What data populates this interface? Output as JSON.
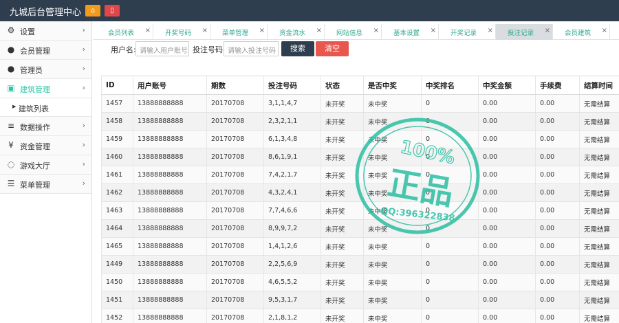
{
  "app": {
    "title": "九城后台管理中心"
  },
  "topbar": {
    "home_icon": "home-icon",
    "trash_icon": "trash-icon",
    "home_color": "#f29a1a",
    "trash_color": "#e0464a"
  },
  "sidebar": {
    "items": [
      {
        "icon": "gear-icon",
        "glyph": "⚙",
        "label": "设置",
        "active": false
      },
      {
        "icon": "user-icon",
        "glyph": "●",
        "label": "会员管理",
        "active": false
      },
      {
        "icon": "users-icon",
        "glyph": "●",
        "label": "管理员",
        "active": false
      },
      {
        "icon": "building-icon",
        "glyph": "▣",
        "label": "建筑管理",
        "active": true
      },
      {
        "icon": "database-icon",
        "glyph": "≡",
        "label": "数据操作",
        "active": false
      },
      {
        "icon": "yen-icon",
        "glyph": "¥",
        "label": "资金管理",
        "active": false
      },
      {
        "icon": "circle-icon",
        "glyph": "◌",
        "label": "游戏大厅",
        "active": false
      },
      {
        "icon": "list-icon",
        "glyph": "☰",
        "label": "菜单管理",
        "active": false
      }
    ],
    "subitem": {
      "label": "建筑列表"
    },
    "accent": "#2ec4a6"
  },
  "tabs": [
    {
      "label": "会员列表",
      "active": false
    },
    {
      "label": "开奖号码",
      "active": false
    },
    {
      "label": "菜单管理",
      "active": false
    },
    {
      "label": "资金流水",
      "active": false
    },
    {
      "label": "网站信息",
      "active": false
    },
    {
      "label": "基本设置",
      "active": false
    },
    {
      "label": "开奖记录",
      "active": false
    },
    {
      "label": "投注记录",
      "active": true
    },
    {
      "label": "会员建筑",
      "active": false
    }
  ],
  "search": {
    "user_label": "用户名:",
    "user_placeholder": "请输入用户账号",
    "bet_label": "投注号码:",
    "bet_placeholder": "请输入投注号码",
    "search_button": "搜索",
    "clear_button": "清空",
    "search_color": "#2f3e4f",
    "clear_color": "#e8574e"
  },
  "table": {
    "columns": [
      "ID",
      "用户账号",
      "期数",
      "投注号码",
      "状态",
      "是否中奖",
      "中奖排名",
      "中奖金额",
      "手续费",
      "结算时间"
    ],
    "rows": [
      [
        "1457",
        "13888888888",
        "20170708",
        "3,1,1,4,7",
        "未开奖",
        "未中奖",
        "0",
        "0.00",
        "0.00",
        "无需结算"
      ],
      [
        "1458",
        "13888888888",
        "20170708",
        "2,3,2,1,1",
        "未开奖",
        "未中奖",
        "0",
        "0.00",
        "0.00",
        "无需结算"
      ],
      [
        "1459",
        "13888888888",
        "20170708",
        "6,1,3,4,8",
        "未开奖",
        "未中奖",
        "0",
        "0.00",
        "0.00",
        "无需结算"
      ],
      [
        "1460",
        "13888888888",
        "20170708",
        "8,6,1,9,1",
        "未开奖",
        "未中奖",
        "0",
        "0.00",
        "0.00",
        "无需结算"
      ],
      [
        "1461",
        "13888888888",
        "20170708",
        "7,4,2,1,7",
        "未开奖",
        "未中奖",
        "0",
        "0.00",
        "0.00",
        "无需结算"
      ],
      [
        "1462",
        "13888888888",
        "20170708",
        "4,3,2,4,1",
        "未开奖",
        "未中奖",
        "0",
        "0.00",
        "0.00",
        "无需结算"
      ],
      [
        "1463",
        "13888888888",
        "20170708",
        "7,7,4,6,6",
        "未开奖",
        "未中奖",
        "0",
        "0.00",
        "0.00",
        "无需结算"
      ],
      [
        "1464",
        "13888888888",
        "20170708",
        "8,9,9,7,2",
        "未开奖",
        "未中奖",
        "0",
        "0.00",
        "0.00",
        "无需结算"
      ],
      [
        "1465",
        "13888888888",
        "20170708",
        "1,4,1,2,6",
        "未开奖",
        "未中奖",
        "0",
        "0.00",
        "0.00",
        "无需结算"
      ],
      [
        "1449",
        "13888888888",
        "20170708",
        "2,2,5,6,9",
        "未开奖",
        "未中奖",
        "0",
        "0.00",
        "0.00",
        "无需结算"
      ],
      [
        "1450",
        "13888888888",
        "20170708",
        "4,6,5,5,2",
        "未开奖",
        "未中奖",
        "0",
        "0.00",
        "0.00",
        "无需结算"
      ],
      [
        "1451",
        "13888888888",
        "20170708",
        "9,5,3,1,7",
        "未开奖",
        "未中奖",
        "0",
        "0.00",
        "0.00",
        "无需结算"
      ],
      [
        "1452",
        "13888888888",
        "20170708",
        "2,1,8,1,2",
        "未开奖",
        "未中奖",
        "0",
        "0.00",
        "0.00",
        "无需结算"
      ]
    ]
  },
  "watermark": {
    "percent": "100%",
    "text": "正品",
    "qq": "QQ:396322838",
    "color": "#2bbfa2"
  }
}
